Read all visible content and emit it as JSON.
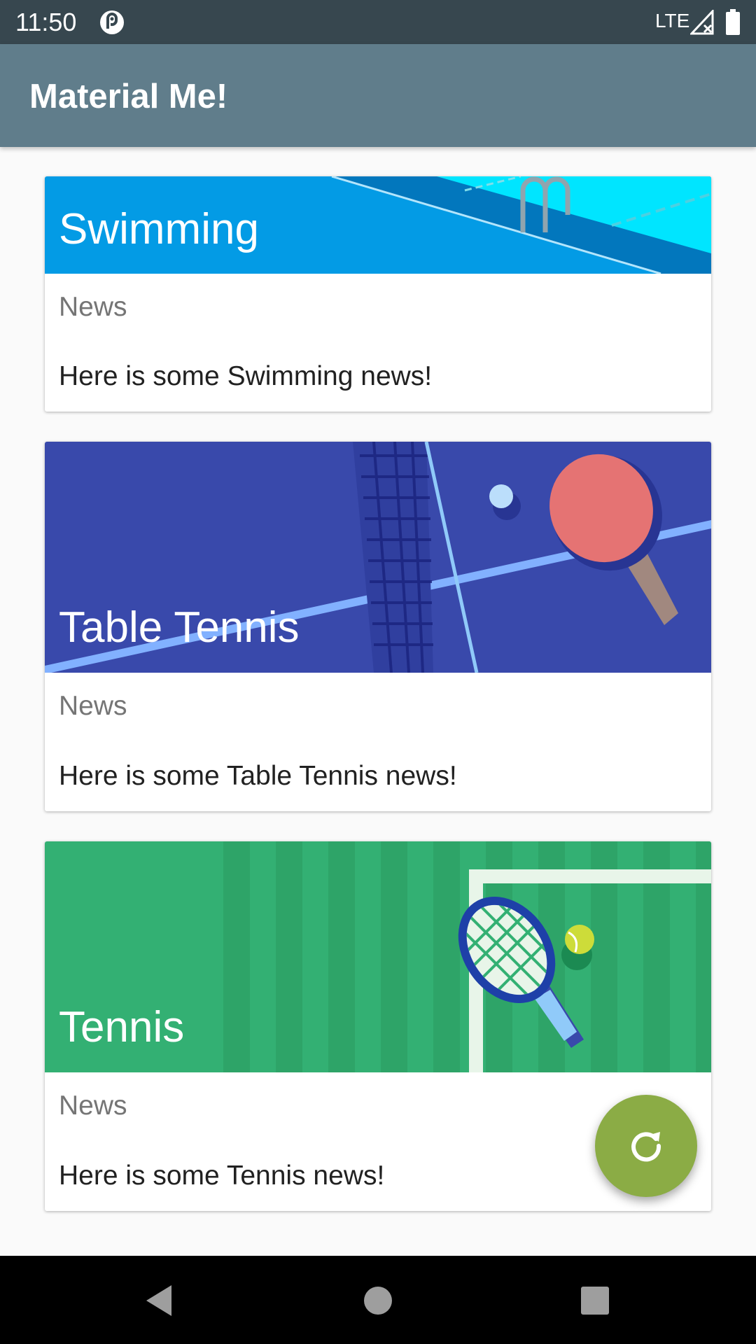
{
  "status_bar": {
    "time": "11:50",
    "network": "LTE",
    "icons": [
      "app-notification-icon",
      "signal-icon",
      "battery-icon"
    ]
  },
  "app_bar": {
    "title": "Material Me!"
  },
  "cards": [
    {
      "title": "Swimming",
      "subtitle": "News",
      "info": "Here is some Swimming news!",
      "image": "swimming-pool-image",
      "color": "#039be5"
    },
    {
      "title": "Table Tennis",
      "subtitle": "News",
      "info": "Here is some Table Tennis news!",
      "image": "table-tennis-image",
      "color": "#3949ab"
    },
    {
      "title": "Tennis",
      "subtitle": "News",
      "info": "Here is some Tennis news!",
      "image": "tennis-court-image",
      "color": "#33b073"
    }
  ],
  "fab": {
    "icon": "refresh-icon",
    "color": "#8bac45"
  },
  "nav_bar": {
    "icons": [
      "back-icon",
      "home-icon",
      "recents-icon"
    ]
  },
  "colors": {
    "status_bar": "#37474f",
    "app_bar": "#607d8b",
    "background": "#fafafa"
  }
}
